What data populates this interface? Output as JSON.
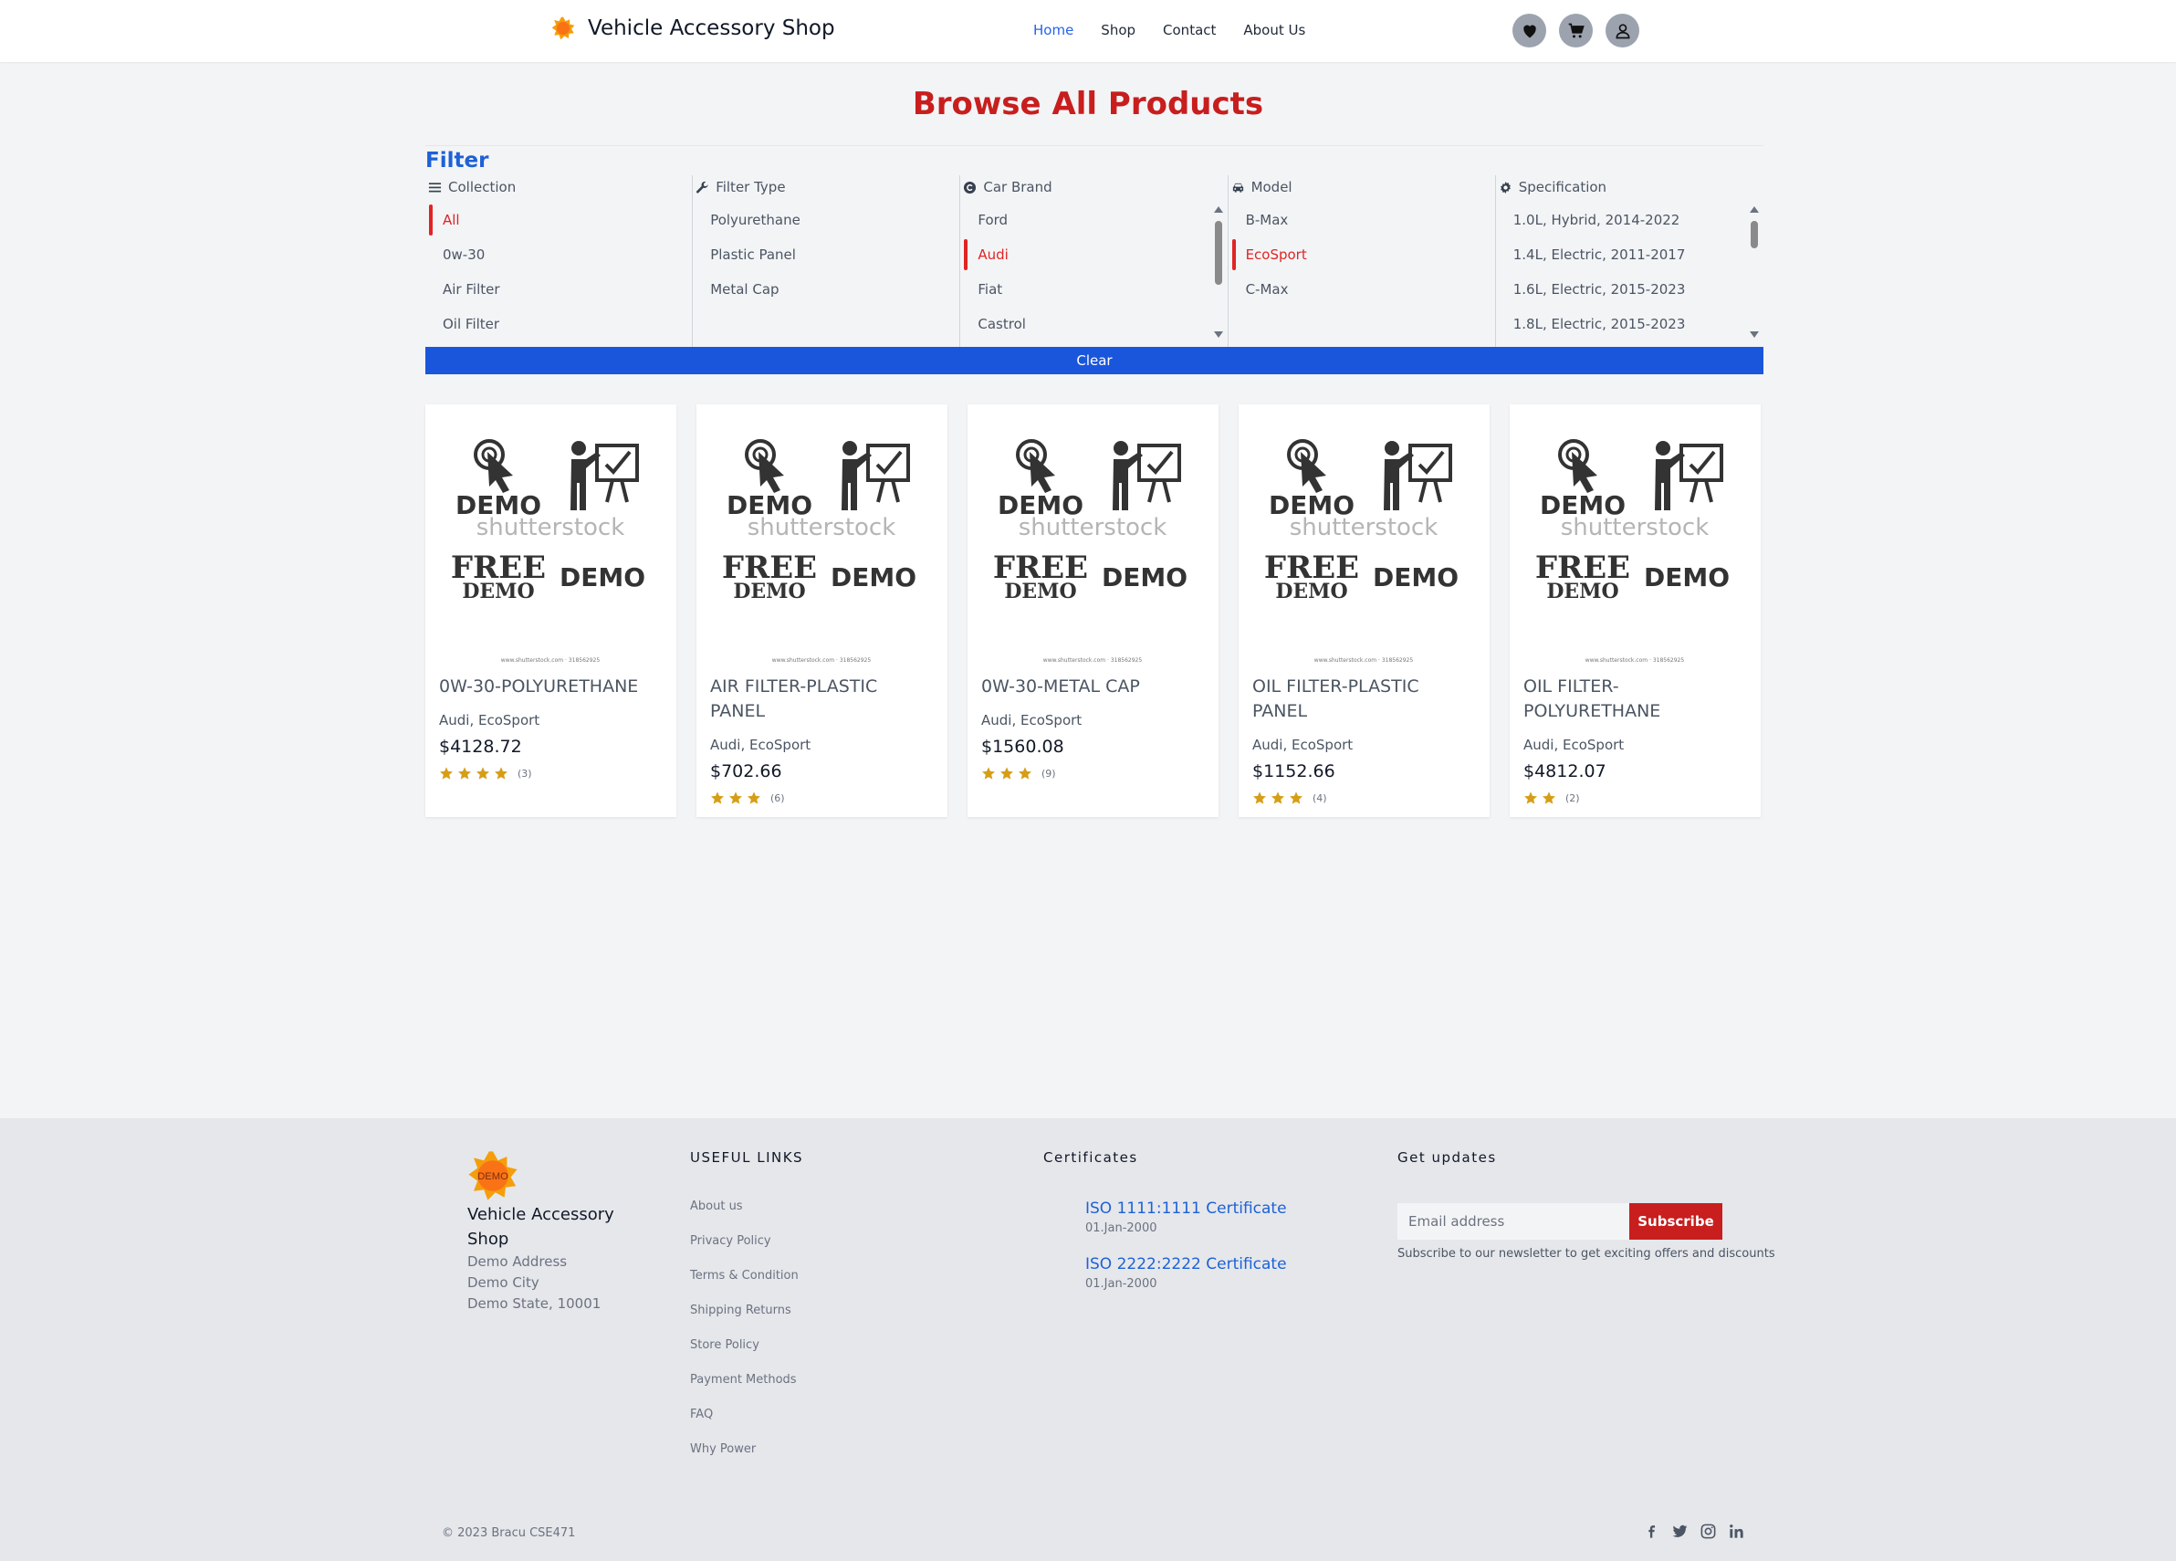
{
  "header": {
    "brand": "Vehicle Accessory Shop",
    "nav": [
      "Home",
      "Shop",
      "Contact",
      "About Us"
    ],
    "active_nav": "Home",
    "icons": [
      "heart-icon",
      "cart-icon",
      "user-icon"
    ]
  },
  "page_title": "Browse All Products",
  "filter": {
    "title": "Filter",
    "clear_label": "Clear",
    "columns": [
      {
        "label": "Collection",
        "icon": "list-icon",
        "items": [
          "All",
          "0w-30",
          "Air Filter",
          "Oil Filter"
        ],
        "selected": "All"
      },
      {
        "label": "Filter Type",
        "icon": "wrench-icon",
        "items": [
          "Polyurethane",
          "Plastic Panel",
          "Metal Cap"
        ],
        "selected": ""
      },
      {
        "label": "Car Brand",
        "icon": "copyright-icon",
        "items": [
          "Ford",
          "Audi",
          "Fiat",
          "Castrol"
        ],
        "selected": "Audi"
      },
      {
        "label": "Model",
        "icon": "car-icon",
        "items": [
          "B-Max",
          "EcoSport",
          "C-Max"
        ],
        "selected": "EcoSport"
      },
      {
        "label": "Specification",
        "icon": "gear-icon",
        "items": [
          "1.0L, Hybrid, 2014-2022",
          "1.4L, Electric, 2011-2017",
          "1.6L, Electric, 2015-2023",
          "1.8L, Electric, 2015-2023"
        ],
        "selected": ""
      }
    ]
  },
  "products": [
    {
      "title": "0W-30-POLYURETHANE",
      "subtitle": "Audi, EcoSport",
      "price": "$4128.72",
      "rating": 4,
      "reviews": "(3)"
    },
    {
      "title": "AIR FILTER-PLASTIC PANEL",
      "subtitle": "Audi, EcoSport",
      "price": "$702.66",
      "rating": 3,
      "reviews": "(6)"
    },
    {
      "title": "0W-30-METAL CAP",
      "subtitle": "Audi, EcoSport",
      "price": "$1560.08",
      "rating": 3,
      "reviews": "(9)"
    },
    {
      "title": "OIL FILTER-PLASTIC PANEL",
      "subtitle": "Audi, EcoSport",
      "price": "$1152.66",
      "rating": 3,
      "reviews": "(4)"
    },
    {
      "title": "OIL FILTER-POLYURETHANE",
      "subtitle": "Audi, EcoSport",
      "price": "$4812.07",
      "rating": 2,
      "reviews": "(2)"
    }
  ],
  "product_image": {
    "line1": "DEMO",
    "line2": "shutterstock",
    "line3": "FREE",
    "line4": "DEMO",
    "line5": "DEMO",
    "caption": "www.shutterstock.com · 318562925"
  },
  "footer": {
    "logo_text": "DEMO",
    "brand": "Vehicle Accessory Shop",
    "address": [
      "Demo Address",
      "Demo City",
      "Demo State, 10001"
    ],
    "useful_links_title": "USEFUL LINKS",
    "useful_links": [
      "About us",
      "Privacy Policy",
      "Terms & Condition",
      "Shipping Returns",
      "Store Policy",
      "Payment Methods",
      "FAQ",
      "Why Power"
    ],
    "certificates_title": "Certificates",
    "certificates": [
      {
        "name": "ISO 1111:1111 Certificate",
        "date": "01.Jan-2000"
      },
      {
        "name": "ISO 2222:2222 Certificate",
        "date": "01.Jan-2000"
      }
    ],
    "updates_title": "Get updates",
    "email_placeholder": "Email address",
    "subscribe_label": "Subscribe",
    "subscribe_note": "Subscribe to our newsletter to get exciting offers and discounts",
    "copyright": "© 2023 Bracu CSE471",
    "social": [
      "facebook-icon",
      "twitter-icon",
      "instagram-icon",
      "linkedin-icon"
    ]
  },
  "colors": {
    "accent_red": "#c81e1e",
    "primary_blue": "#1a56db",
    "star": "#d69e16"
  }
}
